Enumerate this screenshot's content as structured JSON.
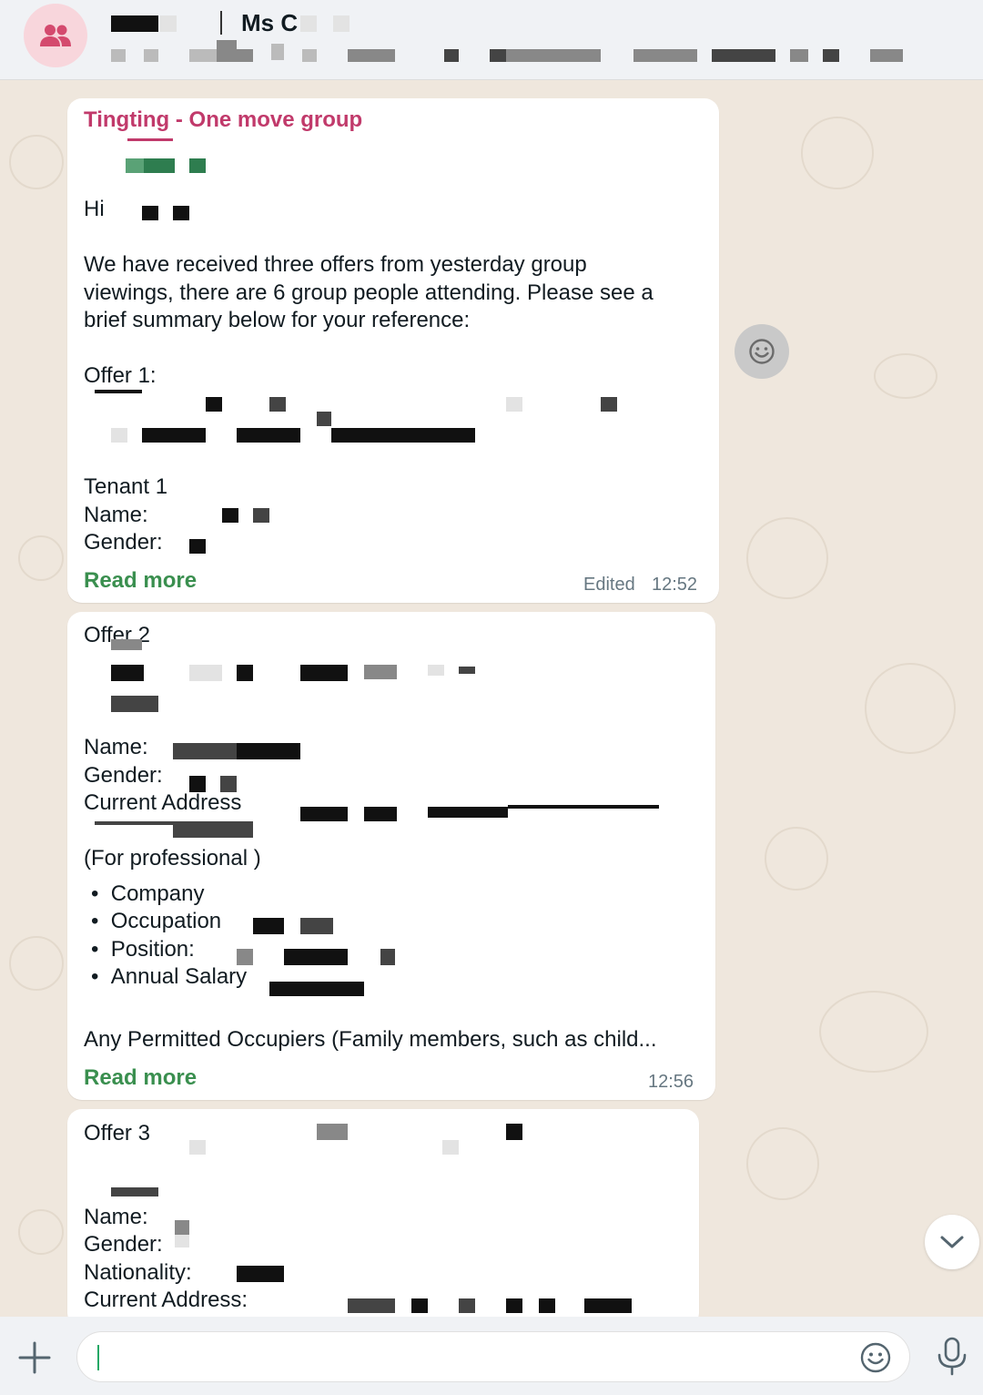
{
  "header": {
    "title": "Ms C",
    "avatar_icon": "group-icon",
    "avatar_color": "#f8d6dc"
  },
  "messages": [
    {
      "sender": "Tingting - One move group",
      "greeting": "Hi",
      "body_line1": "We have received three offers from yesterday group",
      "body_line2": "viewings, there are 6 group people attending. Please see a",
      "body_line3": "brief summary below for your reference:",
      "offer_heading": "Offer 1:",
      "tenant": "Tenant 1",
      "name_label": "Name:",
      "gender_label": "Gender:",
      "read_more": "Read more",
      "edited": "Edited",
      "time": "12:52"
    },
    {
      "offer_heading": "Offer 2",
      "name_label": "Name:",
      "gender_label": "Gender:",
      "address_label": "Current Address",
      "professional": "(For professional )",
      "bullets": [
        "Company",
        "Occupation",
        "Position:",
        "Annual Salary"
      ],
      "occupiers": "Any Permitted Occupiers (Family members, such as child...",
      "read_more": "Read more",
      "time": "12:56"
    },
    {
      "offer_heading": "Offer 3",
      "name_label": "Name:",
      "gender_label": "Gender:",
      "nationality_label": "Nationality:",
      "address_label": "Current Address:"
    }
  ],
  "composer": {
    "value": "",
    "plus_icon": "plus-icon",
    "emoji_icon": "emoji-icon",
    "mic_icon": "microphone-icon"
  },
  "colors": {
    "sender": "#c13a6b",
    "read_more": "#3a8f4f",
    "background": "#efe7dd"
  }
}
